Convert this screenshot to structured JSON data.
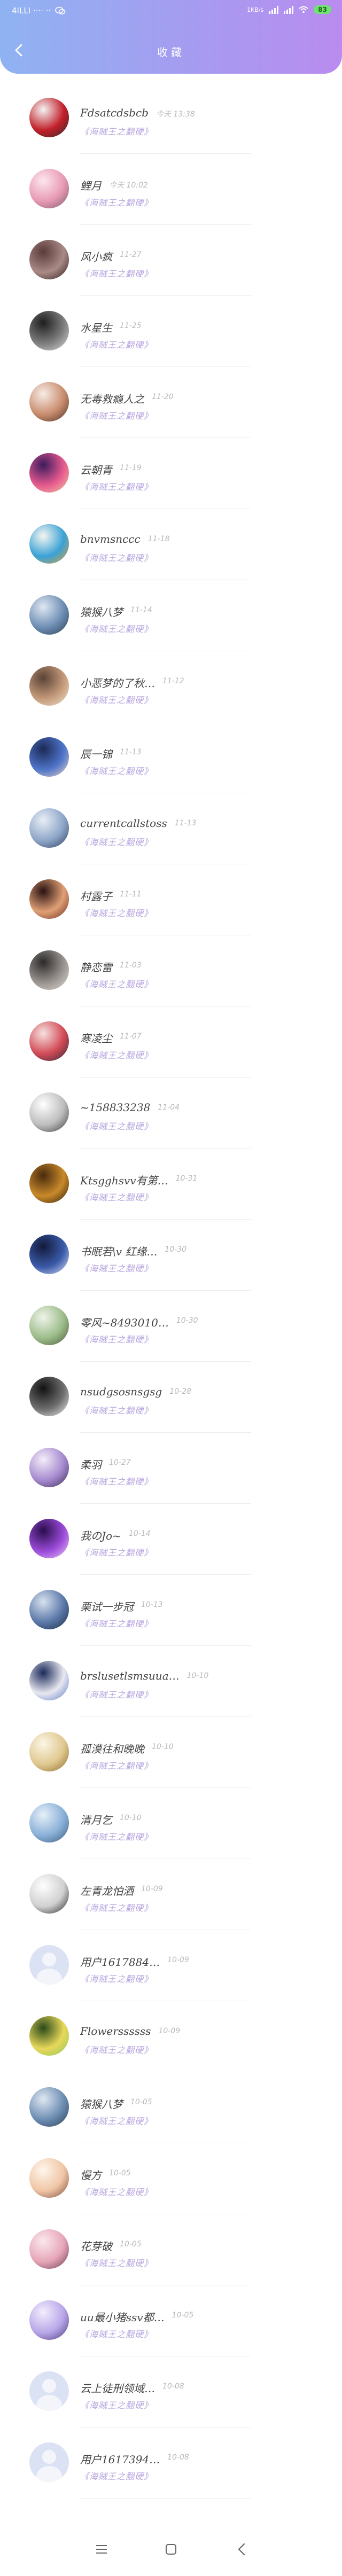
{
  "status": {
    "carrier": "4ILLI ···· ··",
    "right_text": "1KB/s",
    "battery": "83"
  },
  "header": {
    "back_icon": "back-arrow-icon",
    "title": "收藏"
  },
  "subtitle_default": "《海贼王之翻硬》",
  "colors": {
    "header_start": "#8fb3f2",
    "header_end": "#b98cef",
    "subtitle": "#b7a6df"
  },
  "items": [
    {
      "name": "Fdsatcdsbcb",
      "time": "今天 13:38",
      "sub": "《海贼王之翻硬》",
      "avatar": {
        "type": "img",
        "c1": "#f4f4f4",
        "c2": "#c2202a",
        "c3": "#2a2a2a"
      }
    },
    {
      "name": "鲤月",
      "time": "今天 10:02",
      "sub": "《海贼王之翻硬》",
      "avatar": {
        "type": "img",
        "c1": "#fde6ee",
        "c2": "#e89ab3",
        "c3": "#7a5b6e"
      }
    },
    {
      "name": "风小疯",
      "time": "11-27",
      "sub": "《海贼王之翻硬》",
      "avatar": {
        "type": "img",
        "c1": "#5b3a3a",
        "c2": "#a98a86",
        "c3": "#2c1b1b"
      }
    },
    {
      "name": "水星生",
      "time": "11-25",
      "sub": "《海贼王之翻硬》",
      "avatar": {
        "type": "img",
        "c1": "#1e1e1e",
        "c2": "#7d7d7d",
        "c3": "#dcdcdc"
      }
    },
    {
      "name": "无毒救瘾人之",
      "time": "11-20",
      "sub": "《海贼王之翻硬》",
      "avatar": {
        "type": "img",
        "c1": "#f7ece5",
        "c2": "#c98d6f",
        "c3": "#4a3028"
      }
    },
    {
      "name": "云朝青",
      "time": "11-19",
      "sub": "《海贼王之翻硬》",
      "avatar": {
        "type": "img",
        "c1": "#3b1b5e",
        "c2": "#e65a8e",
        "c3": "#f2c9a0"
      }
    },
    {
      "name": "bnvmsnccc",
      "time": "11-18",
      "sub": "《海贼王之翻硬》",
      "avatar": {
        "type": "img",
        "c1": "#f6f6f0",
        "c2": "#3aa1d6",
        "c3": "#e2a43b"
      }
    },
    {
      "name": "猿猴八梦",
      "time": "11-14",
      "sub": "《海贼王之翻硬》",
      "avatar": {
        "type": "img",
        "c1": "#dfe8f2",
        "c2": "#6d8db3",
        "c3": "#2c3d52"
      }
    },
    {
      "name": "小恶梦的了秋…",
      "time": "11-12",
      "sub": "《海贼王之翻硬》",
      "avatar": {
        "type": "img",
        "c1": "#5b4236",
        "c2": "#c49a7a",
        "c3": "#f1e3d0"
      }
    },
    {
      "name": "辰一锦",
      "time": "11-13",
      "sub": "《海贼王之翻硬》",
      "avatar": {
        "type": "img",
        "c1": "#1b2a57",
        "c2": "#4f74c9",
        "c3": "#e9d7c4"
      }
    },
    {
      "name": "currentcallstoss",
      "time": "11-13",
      "sub": "《海贼王之翻硬》",
      "avatar": {
        "type": "img",
        "c1": "#e8eef6",
        "c2": "#8ea6c8",
        "c3": "#2d3e5c"
      }
    },
    {
      "name": "村露子",
      "time": "11-11",
      "sub": "《海贼王之翻硬》",
      "avatar": {
        "type": "img",
        "c1": "#2a1212",
        "c2": "#e0a075",
        "c3": "#6a2a1e"
      }
    },
    {
      "name": "静恋雷",
      "time": "11-03",
      "sub": "《海贼王之翻硬》",
      "avatar": {
        "type": "img",
        "c1": "#2c2a2a",
        "c2": "#9a9490",
        "c3": "#e2dcd6"
      }
    },
    {
      "name": "寒凌尘",
      "time": "11-07",
      "sub": "《海贼王之翻硬》",
      "avatar": {
        "type": "img",
        "c1": "#f6e2e0",
        "c2": "#d24a56",
        "c3": "#2a2a3a"
      }
    },
    {
      "name": "~158833238",
      "time": "11-04",
      "sub": "《海贼王之翻硬》",
      "avatar": {
        "type": "img",
        "c1": "#ffffff",
        "c2": "#bdbdbd",
        "c3": "#3a3a3a"
      }
    },
    {
      "name": "Ktsgghsvv有第…",
      "time": "10-31",
      "sub": "《海贼王之翻硬》",
      "avatar": {
        "type": "img",
        "c1": "#4a2a0e",
        "c2": "#c98a2a",
        "c3": "#2a1a0a"
      }
    },
    {
      "name": "书眠若\\v 红缘…",
      "time": "10-30",
      "sub": "《海贼王之翻硬》",
      "avatar": {
        "type": "img",
        "c1": "#121a3a",
        "c2": "#3a5aa8",
        "c3": "#dfe6f8"
      }
    },
    {
      "name": "零风~8493010…",
      "time": "10-30",
      "sub": "《海贼王之翻硬》",
      "avatar": {
        "type": "img",
        "c1": "#f0f4ea",
        "c2": "#9cbc8a",
        "c3": "#4a5a3a"
      }
    },
    {
      "name": "nsudgsosnsgsg",
      "time": "10-28",
      "sub": "《海贼王之翻硬》",
      "avatar": {
        "type": "img",
        "c1": "#121212",
        "c2": "#6e6e6e",
        "c3": "#f4f4f4"
      }
    },
    {
      "name": "柔羽",
      "time": "10-27",
      "sub": "《海贼王之翻硬》",
      "avatar": {
        "type": "img",
        "c1": "#f4eef8",
        "c2": "#a68ad0",
        "c3": "#3a2a4e"
      }
    },
    {
      "name": "我のJo~",
      "time": "10-14",
      "sub": "《海贼王之翻硬》",
      "avatar": {
        "type": "img",
        "c1": "#2a0e4e",
        "c2": "#9a4ad8",
        "c3": "#f0c8f8"
      }
    },
    {
      "name": "栗试一步冠",
      "time": "10-13",
      "sub": "《海贼王之翻硬》",
      "avatar": {
        "type": "img",
        "c1": "#d8e2f0",
        "c2": "#5a78a8",
        "c3": "#1e2a42"
      }
    },
    {
      "name": "brslusetlsmsuua…",
      "time": "10-10",
      "sub": "《海贼王之翻硬》",
      "avatar": {
        "type": "img",
        "c1": "#1a2a5a",
        "c2": "#e8e8f0",
        "c3": "#5a7ac8"
      }
    },
    {
      "name": "孤漠往和晚晚",
      "time": "10-10",
      "sub": "《海贼王之翻硬》",
      "avatar": {
        "type": "img",
        "c1": "#fbf6e6",
        "c2": "#e0c890",
        "c3": "#8a6a2a"
      }
    },
    {
      "name": "清月乞",
      "time": "10-10",
      "sub": "《海贼王之翻硬》",
      "avatar": {
        "type": "img",
        "c1": "#e6f0f8",
        "c2": "#8ab0d8",
        "c3": "#3a5a7a"
      }
    },
    {
      "name": "左青龙怕酒",
      "time": "10-09",
      "sub": "《海贼王之翻硬》",
      "avatar": {
        "type": "img",
        "c1": "#ffffff",
        "c2": "#d0d0d0",
        "c3": "#222222"
      }
    },
    {
      "name": "用户1617884…",
      "time": "10-09",
      "sub": "《海贼王之翻硬》",
      "avatar": {
        "type": "placeholder"
      }
    },
    {
      "name": "Flowerssssss",
      "time": "10-09",
      "sub": "《海贼王之翻硬》",
      "avatar": {
        "type": "img",
        "c1": "#2a4a1a",
        "c2": "#e8d85a",
        "c3": "#8ac85a"
      }
    },
    {
      "name": "猿猴八梦",
      "time": "10-05",
      "sub": "《海贼王之翻硬》",
      "avatar": {
        "type": "img",
        "c1": "#dfe8f2",
        "c2": "#6d8db3",
        "c3": "#2c3d52"
      }
    },
    {
      "name": "慢方",
      "time": "10-05",
      "sub": "《海贼王之翻硬》",
      "avatar": {
        "type": "img",
        "c1": "#fff6ec",
        "c2": "#f0c6a6",
        "c3": "#7a4a3a"
      }
    },
    {
      "name": "花芽破",
      "time": "10-05",
      "sub": "《海贼王之翻硬》",
      "avatar": {
        "type": "img",
        "c1": "#fbe8ee",
        "c2": "#e6a6b8",
        "c3": "#6a3a4a"
      }
    },
    {
      "name": "uu最小猪ssv都…",
      "time": "10-05",
      "sub": "《海贼王之翻硬》",
      "avatar": {
        "type": "img",
        "c1": "#f2eefc",
        "c2": "#b8a6e8",
        "c3": "#4a3a7a"
      }
    },
    {
      "name": "云上徒刑领域…",
      "time": "10-08",
      "sub": "《海贼王之翻硬》",
      "avatar": {
        "type": "placeholder"
      }
    },
    {
      "name": "用户1617394…",
      "time": "10-08",
      "sub": "《海贼王之翻硬》",
      "avatar": {
        "type": "placeholder"
      }
    }
  ],
  "nav": {
    "menu_icon": "menu-icon",
    "home_icon": "home-square-icon",
    "back_icon": "back-triangle-icon"
  }
}
